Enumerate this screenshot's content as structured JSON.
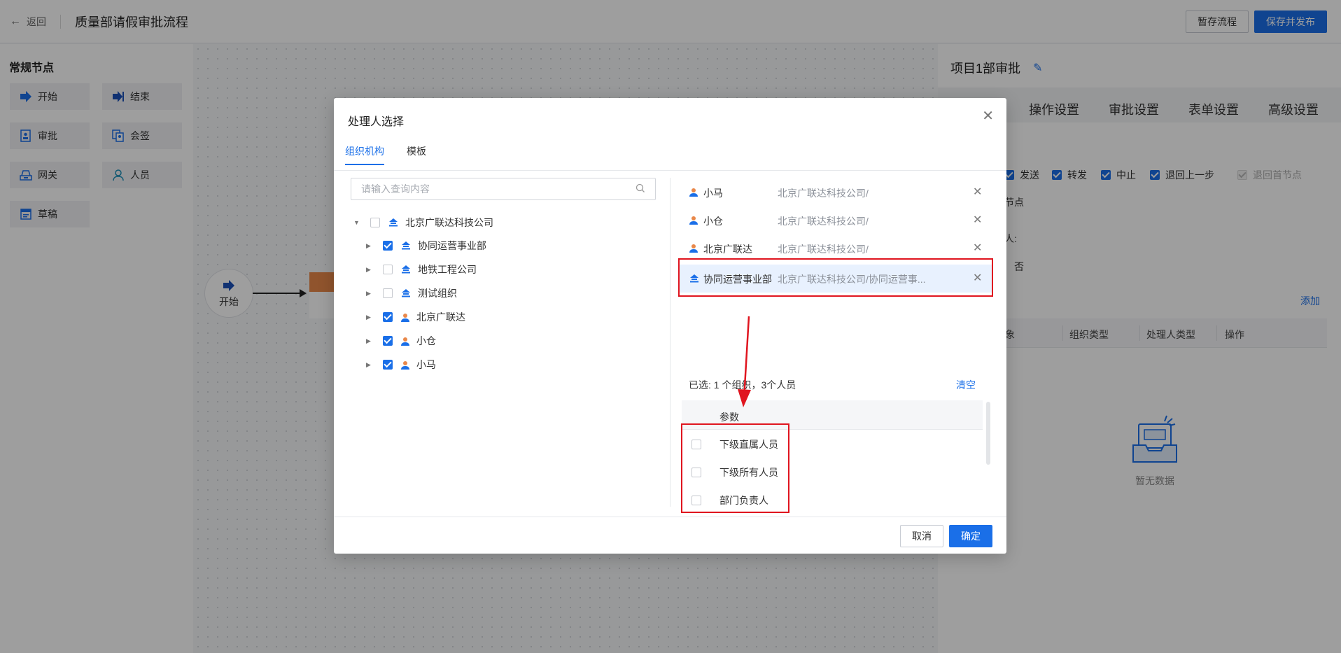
{
  "topbar": {
    "back_label": "返回",
    "title": "质量部请假审批流程",
    "save_draft": "暂存流程",
    "save_publish": "保存并发布"
  },
  "palette": {
    "heading": "常规节点",
    "nodes": [
      {
        "label": "开始",
        "icon": "arrow-right-icon"
      },
      {
        "label": "结束",
        "icon": "arrow-right-end-icon"
      },
      {
        "label": "审批",
        "icon": "approve-doc-icon"
      },
      {
        "label": "会签",
        "icon": "countersign-icon"
      },
      {
        "label": "网关",
        "icon": "gateway-icon"
      },
      {
        "label": "人员",
        "icon": "person-icon"
      },
      {
        "label": "草稿",
        "icon": "draft-icon"
      }
    ]
  },
  "canvas": {
    "start_label": "开始"
  },
  "right_panel": {
    "title": "项目1部审批",
    "tabs": [
      "操作设置",
      "审批设置",
      "表单设置",
      "高级设置"
    ],
    "checks": [
      {
        "label": "发送",
        "checked": true,
        "disabled": false
      },
      {
        "label": "转发",
        "checked": true,
        "disabled": false
      },
      {
        "label": "中止",
        "checked": true,
        "disabled": false
      },
      {
        "label": "退回上一步",
        "checked": true,
        "disabled": false
      },
      {
        "label": "退回首节点",
        "checked": true,
        "disabled": true
      }
    ],
    "text_node": "节点",
    "text_person": "人:",
    "text_no": "否",
    "add": "添加",
    "columns": [
      "象",
      "组织类型",
      "处理人类型",
      "操作"
    ],
    "empty_text": "暂无数据"
  },
  "modal": {
    "title": "处理人选择",
    "tabs": [
      "组织机构",
      "模板"
    ],
    "search_placeholder": "请输入查询内容",
    "tree": [
      {
        "label": "北京广联达科技公司",
        "level": 0,
        "expanded": true,
        "checked": false,
        "type": "org"
      },
      {
        "label": "协同运营事业部",
        "level": 1,
        "expanded": false,
        "checked": true,
        "type": "org"
      },
      {
        "label": "地铁工程公司",
        "level": 1,
        "expanded": false,
        "checked": false,
        "type": "org"
      },
      {
        "label": "测试组织",
        "level": 1,
        "expanded": false,
        "checked": false,
        "type": "org"
      },
      {
        "label": "北京广联达",
        "level": 1,
        "expanded": false,
        "checked": true,
        "type": "person"
      },
      {
        "label": "小仓",
        "level": 1,
        "expanded": false,
        "checked": true,
        "type": "person"
      },
      {
        "label": "小马",
        "level": 1,
        "expanded": false,
        "checked": true,
        "type": "person"
      }
    ],
    "selected": [
      {
        "name": "小马",
        "path": "北京广联达科技公司/",
        "type": "person"
      },
      {
        "name": "小仓",
        "path": "北京广联达科技公司/",
        "type": "person"
      },
      {
        "name": "北京广联达",
        "path": "北京广联达科技公司/",
        "type": "person"
      },
      {
        "name": "协同运营事业部",
        "path": "北京广联达科技公司/协同运营事...",
        "type": "org"
      }
    ],
    "summary": "已选:  1 个组织，3个人员",
    "clear": "清空",
    "param_header": "参数",
    "params": [
      "下级直属人员",
      "下级所有人员",
      "部门负责人"
    ],
    "cancel": "取消",
    "confirm": "确定"
  },
  "colors": {
    "primary": "#1a6fe8",
    "highlight_box": "#e0151f",
    "approve_node": "#e9884a"
  }
}
